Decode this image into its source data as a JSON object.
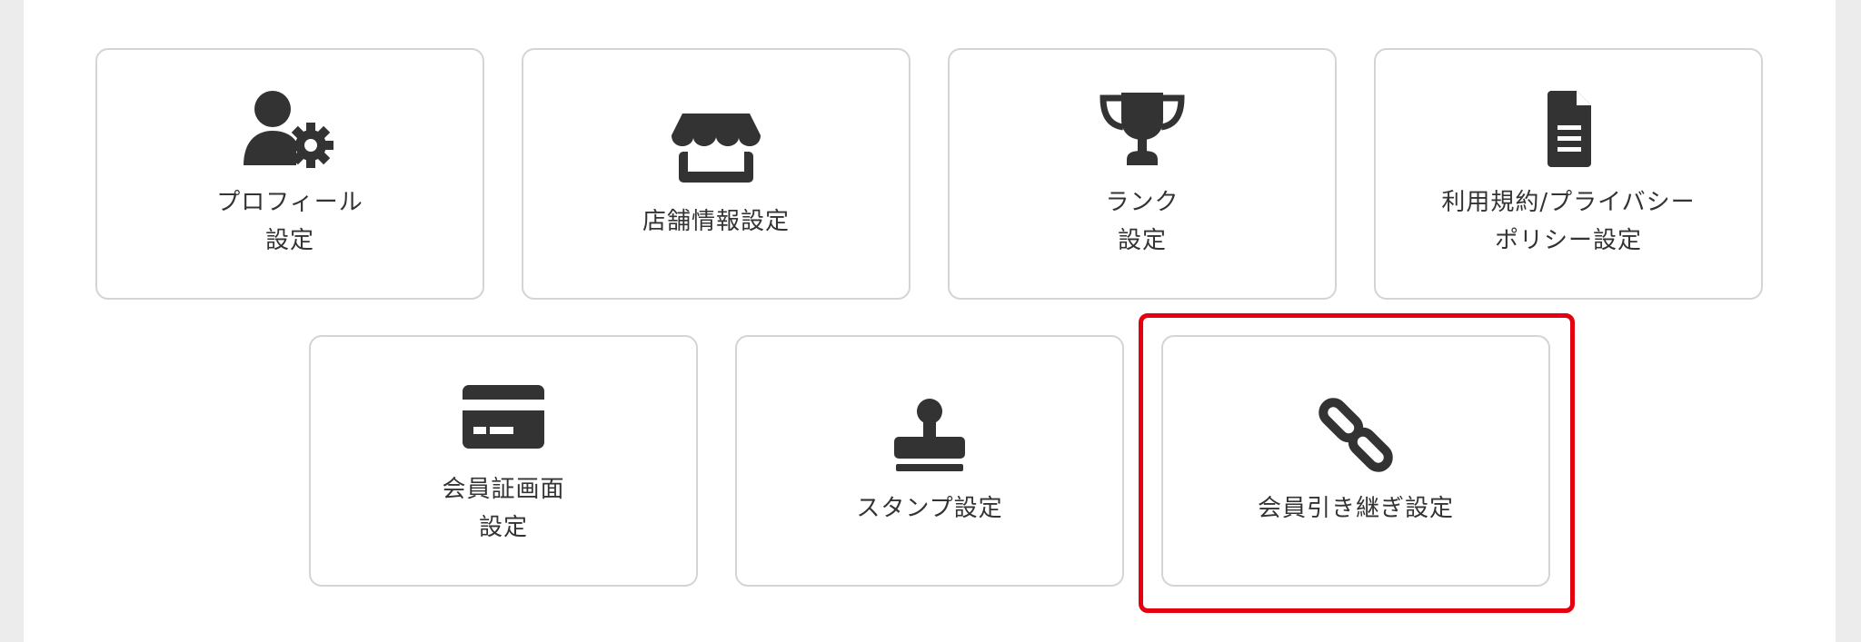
{
  "settings_menu": {
    "cards": [
      {
        "icon": "user-gear-icon",
        "lines": [
          "プロフィール",
          "設定"
        ]
      },
      {
        "icon": "store-icon",
        "lines": [
          "店舗情報設定"
        ]
      },
      {
        "icon": "trophy-icon",
        "lines": [
          "ランク",
          "設定"
        ]
      },
      {
        "icon": "document-icon",
        "lines": [
          "利用規約/プライバシー",
          "ポリシー設定"
        ]
      },
      {
        "icon": "card-icon",
        "lines": [
          "会員証画面",
          "設定"
        ]
      },
      {
        "icon": "stamp-icon",
        "lines": [
          "スタンプ設定"
        ]
      },
      {
        "icon": "link-icon",
        "lines": [
          "会員引き継ぎ設定"
        ]
      }
    ],
    "highlighted_card": "会員引き継ぎ設定"
  },
  "colors": {
    "panel_background": "#ffffff",
    "page_background": "#ececec",
    "card_border": "#d4d4d4",
    "icon": "#333333",
    "text": "#333333",
    "highlight": "#e5000f"
  }
}
